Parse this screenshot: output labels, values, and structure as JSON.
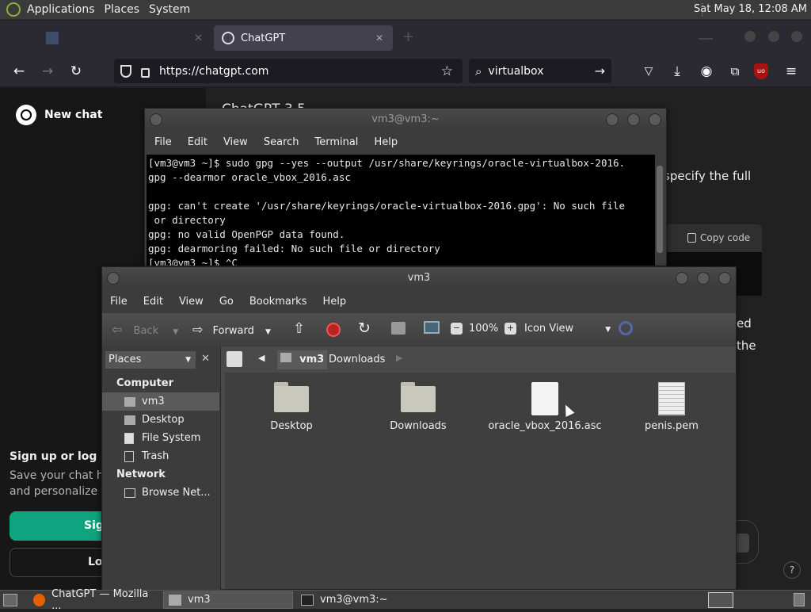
{
  "top_panel": {
    "menus": [
      "Applications",
      "Places",
      "System"
    ],
    "clock": "Sat May 18, 12:08 AM"
  },
  "browser": {
    "tabs": [
      {
        "label": "",
        "active": false
      },
      {
        "label": "ChatGPT",
        "active": true
      }
    ],
    "url": "https://chatgpt.com",
    "search_value": "virtualbox",
    "extension_badge": "uo"
  },
  "chatgpt": {
    "new_chat": "New chat",
    "model_title": "ChatGPT 3.5",
    "signup_title": "Sign up or log in",
    "signup_text1": "Save your chat hist",
    "signup_text2": "and personalize yo",
    "signup_button": "Sig",
    "login_button": "Lo",
    "partial_line1": "specify the full",
    "copy_code": "Copy code",
    "partial_ed": "ed",
    "partial_the": "the",
    "help": "?"
  },
  "terminal": {
    "title": "vm3@vm3:~",
    "menus": [
      "File",
      "Edit",
      "View",
      "Search",
      "Terminal",
      "Help"
    ],
    "lines": [
      "[vm3@vm3 ~]$ sudo gpg --yes --output /usr/share/keyrings/oracle-virtualbox-2016.",
      "gpg --dearmor oracle_vbox_2016.asc",
      "",
      "gpg: can't create '/usr/share/keyrings/oracle-virtualbox-2016.gpg': No such file",
      " or directory",
      "gpg: no valid OpenPGP data found.",
      "gpg: dearmoring failed: No such file or directory",
      "[vm3@vm3 ~]$ ^C"
    ]
  },
  "file_manager": {
    "title": "vm3",
    "menus": [
      "File",
      "Edit",
      "View",
      "Go",
      "Bookmarks",
      "Help"
    ],
    "back": "Back",
    "forward": "Forward",
    "zoom": "100%",
    "view_mode": "Icon View",
    "places_label": "Places",
    "breadcrumb": [
      "vm3",
      "Downloads"
    ],
    "sections": [
      {
        "title": "Computer",
        "items": [
          "vm3",
          "Desktop",
          "File System",
          "Trash"
        ]
      },
      {
        "title": "Network",
        "items": [
          "Browse Net..."
        ]
      }
    ],
    "files": [
      "Desktop",
      "Downloads",
      "oracle_vbox_2016.asc",
      "penis.pem"
    ]
  },
  "taskbar": {
    "items": [
      "ChatGPT — Mozilla ...",
      "vm3",
      "vm3@vm3:~"
    ]
  },
  "colors": {
    "accent_green": "#10a37f",
    "terminal_bg": "#000000",
    "panel_bg": "#3b3b3b"
  }
}
